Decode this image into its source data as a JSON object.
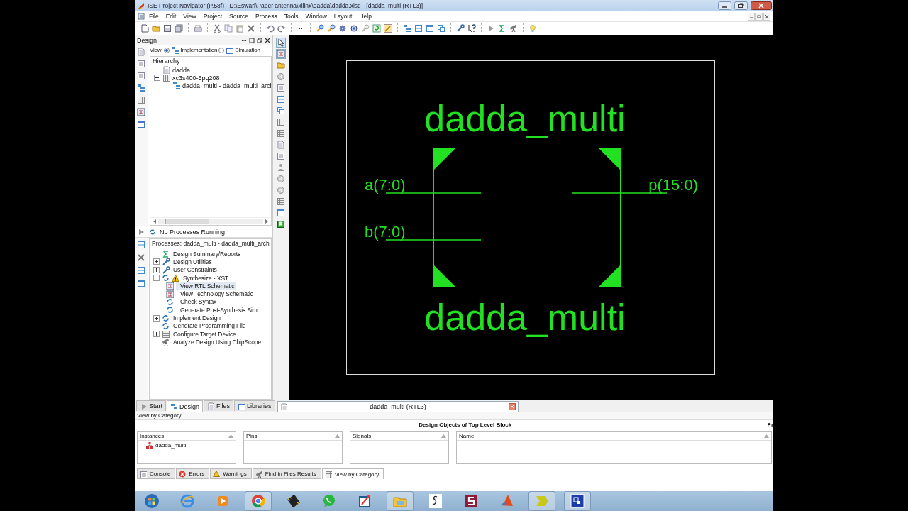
{
  "window": {
    "title": "ISE Project Navigator (P.58f) - D:\\Eswari\\Paper antenna\\xilinx\\dadda\\dadda.xise - [dadda_multi (RTL3)]"
  },
  "menu": [
    "File",
    "Edit",
    "View",
    "Project",
    "Source",
    "Process",
    "Tools",
    "Window",
    "Layout",
    "Help"
  ],
  "design_panel": {
    "title": "Design",
    "view_label": "View:",
    "views": [
      {
        "label": "Implementation",
        "selected": true
      },
      {
        "label": "Simulation",
        "selected": false
      }
    ],
    "hierarchy_title": "Hierarchy",
    "hierarchy": [
      {
        "label": "dadda",
        "kind": "project"
      },
      {
        "label": "xc3s400-5pq208",
        "kind": "chip",
        "expanded": true,
        "children": [
          {
            "label": "dadda_multi - dadda_multi_arcl",
            "kind": "module"
          }
        ]
      }
    ]
  },
  "status": "No Processes Running",
  "processes": {
    "title": "Processes: dadda_multi - dadda_multi_arch",
    "items": [
      {
        "label": "Design Summary/Reports",
        "kind": "summary",
        "selected": false,
        "warning": false
      },
      {
        "label": "Design Utilities",
        "kind": "tools",
        "expanded": false,
        "selected": false,
        "warning": false
      },
      {
        "label": "User Constraints",
        "kind": "tools",
        "expanded": false,
        "selected": false,
        "warning": false
      },
      {
        "label": "Synthesize - XST",
        "kind": "run",
        "expanded": true,
        "selected": false,
        "warning": true,
        "children": [
          {
            "label": "View RTL Schematic",
            "kind": "schematic",
            "selected": true
          },
          {
            "label": "View Technology Schematic",
            "kind": "schematic",
            "selected": false
          },
          {
            "label": "Check Syntax",
            "kind": "run",
            "selected": false
          },
          {
            "label": "Generate Post-Synthesis Sim...",
            "kind": "run",
            "selected": false
          }
        ]
      },
      {
        "label": "Implement Design",
        "kind": "run",
        "expanded": false,
        "selected": false,
        "warning": false
      },
      {
        "label": "Generate Programming File",
        "kind": "run",
        "selected": false,
        "warning": false
      },
      {
        "label": "Configure Target Device",
        "kind": "device",
        "expanded": false,
        "selected": false,
        "warning": false
      },
      {
        "label": "Analyze Design Using ChipScope",
        "kind": "probe",
        "selected": false,
        "warning": false
      }
    ]
  },
  "panel_tabs": [
    {
      "label": "Start",
      "selected": false
    },
    {
      "label": "Design",
      "selected": true
    },
    {
      "label": "Files",
      "selected": false
    },
    {
      "label": "Libraries",
      "selected": false
    }
  ],
  "document_tab": {
    "label": "dadda_multi (RTL3)"
  },
  "schematic": {
    "title": "dadda_multi",
    "instance": "dadda_multi",
    "inputs": [
      "a(7:0)",
      "b(7:0)"
    ],
    "outputs": [
      "p(15:0)"
    ]
  },
  "objects": {
    "view_label": "View by Category",
    "heading": "Design Objects of Top Level Block",
    "side_heading": "Pr",
    "columns": [
      {
        "title": "Instances",
        "items": [
          "dadda_multi"
        ]
      },
      {
        "title": "Pins"
      },
      {
        "title": "Signals"
      },
      {
        "title": "Name"
      }
    ]
  },
  "console_tabs": [
    {
      "label": "Console",
      "selected": false
    },
    {
      "label": "Errors",
      "selected": false
    },
    {
      "label": "Warnings",
      "selected": false
    },
    {
      "label": "Find in Files Results",
      "selected": false
    },
    {
      "label": "View by Category",
      "selected": true
    }
  ]
}
